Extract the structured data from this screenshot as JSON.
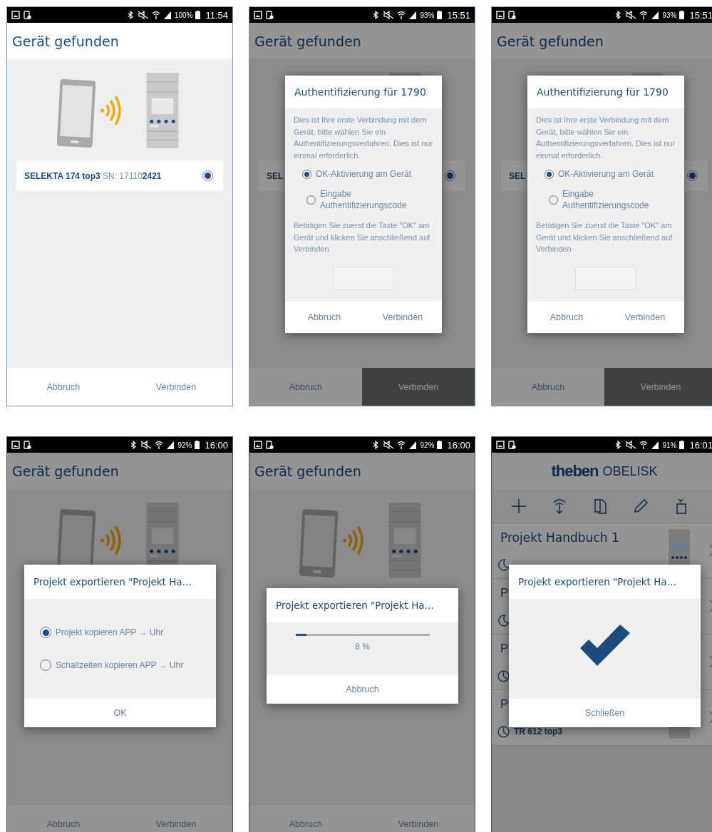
{
  "screens": [
    {
      "status_bar": {
        "battery": "100%",
        "time": "11:54"
      },
      "screen": {
        "kind": "device_found",
        "title": "Gerät gefunden",
        "device_row": {
          "label": "**SELEKTA 174 top3** SN: 17110**2421**",
          "selected": true
        },
        "buttons": [
          {
            "label": "Abbruch",
            "disabled": false
          },
          {
            "label": "Verbinden",
            "disabled": false
          }
        ]
      }
    },
    {
      "status_bar": {
        "battery": "93%",
        "time": "15:51"
      },
      "screen": {
        "kind": "device_found",
        "title": "Gerät gefunden",
        "device_row": {
          "label": "**SEL**",
          "selected": true
        },
        "buttons": [
          {
            "label": "Abbruch",
            "disabled": false
          },
          {
            "label": "Verbinden",
            "disabled": true
          }
        ]
      },
      "dialog": {
        "kind": "auth",
        "title": "Authentifizierung für 1790",
        "text": "Dies ist Ihre erste Verbindung mit dem Gerät, bitte wählen Sie ein Authentifizierungsverfahren. Dies ist nur einmal erforderlich.",
        "options": [
          {
            "label": "OK-Aktivierung am Gerät",
            "selected": true
          },
          {
            "label": "Eingabe Authentifizierungscode",
            "selected": false
          }
        ],
        "hint": "Betätigen Sie zuerst die Taste \"OK\" am Gerät und klicken Sie anschließend auf Verbinden",
        "buttons": [
          "Abbruch",
          "Verbinden"
        ]
      }
    },
    {
      "status_bar": {
        "battery": "93%",
        "time": "15:51"
      },
      "screen": {
        "kind": "device_found",
        "title": "Gerät gefunden",
        "device_row": {
          "label": "**SEL**",
          "selected": true
        },
        "buttons": [
          {
            "label": "Abbruch",
            "disabled": false
          },
          {
            "label": "Verbinden",
            "disabled": true
          }
        ]
      },
      "dialog": {
        "kind": "auth",
        "title": "Authentifizierung für 1790",
        "text": "Dies ist Ihre erste Verbindung mit dem Gerät, bitte wählen Sie ein Authentifizierungsverfahren. Dies ist nur einmal erforderlich.",
        "options": [
          {
            "label": "OK-Aktivierung am Gerät",
            "selected": true
          },
          {
            "label": "Eingabe Authentifizierungscode",
            "selected": false
          }
        ],
        "hint": "Betätigen Sie zuerst die Taste \"OK\" am Gerät und klicken Sie anschließend auf Verbinden",
        "buttons": [
          "Abbruch",
          "Verbinden"
        ]
      }
    },
    {
      "status_bar": {
        "battery": "92%",
        "time": "16:00"
      },
      "screen": {
        "kind": "device_found",
        "title": "Gerät gefunden",
        "buttons": [
          {
            "label": "Abbruch",
            "disabled": false
          },
          {
            "label": "Verbinden",
            "disabled": false
          }
        ]
      },
      "dialog": {
        "kind": "export_options",
        "title": "Projekt exportieren \"Projekt Ha…",
        "options": [
          {
            "label": "Projekt kopieren APP → Uhr",
            "selected": true
          },
          {
            "label": "Schaltzeiten kopieren APP → Uhr",
            "selected": false
          }
        ],
        "buttons": [
          "OK"
        ]
      }
    },
    {
      "status_bar": {
        "battery": "92%",
        "time": "16:00"
      },
      "screen": {
        "kind": "device_found",
        "title": "Gerät gefunden",
        "buttons": [
          {
            "label": "Abbruch",
            "disabled": false
          },
          {
            "label": "Verbinden",
            "disabled": false
          }
        ]
      },
      "dialog": {
        "kind": "export_progress",
        "title": "Projekt exportieren \"Projekt Ha…",
        "level": 0.08,
        "reading": "8 %",
        "buttons": [
          "Abbruch"
        ]
      }
    },
    {
      "status_bar": {
        "battery": "91%",
        "time": "16:01"
      },
      "screen": {
        "kind": "project_list",
        "brand": "theben",
        "product": "OBELISK",
        "projects": [
          {
            "title": "Projekt Handbuch 1",
            "kind": "moon",
            "thumbnail": true
          },
          {
            "title": "P",
            "kind": "moon",
            "thumbnail": false
          },
          {
            "title": "P",
            "kind": "clock",
            "thumbnail": false
          },
          {
            "title": "P",
            "kind": "clock",
            "subtitle": "TR 612 top3",
            "thumbnail": true
          }
        ]
      },
      "dialog": {
        "kind": "export_done",
        "title": "Projekt exportieren \"Projekt Ha…",
        "buttons": [
          "Schließen"
        ]
      }
    }
  ]
}
